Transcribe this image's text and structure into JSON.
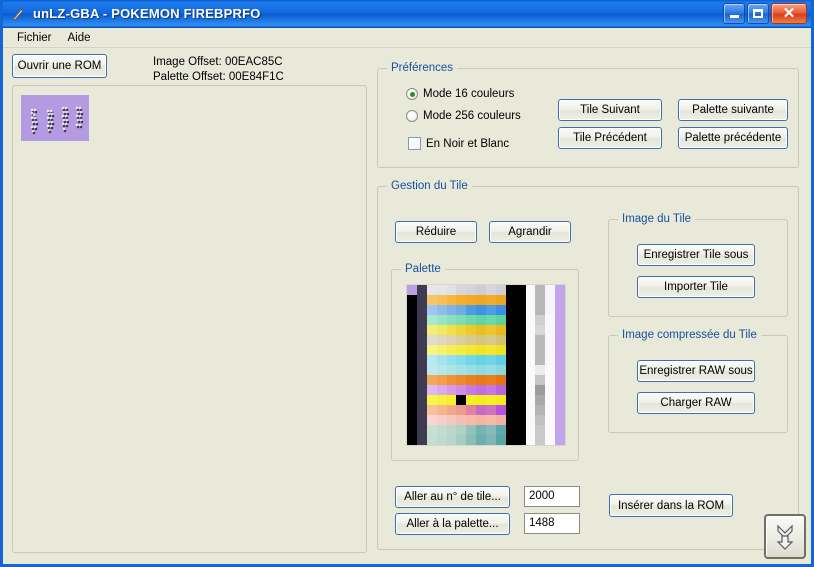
{
  "window": {
    "title": "unLZ-GBA - POKEMON FIREBPRFO",
    "app_icon": "feather-icon",
    "minimize_label": "–",
    "maximize_label": "□",
    "close_label": "✕"
  },
  "menu": {
    "items": [
      {
        "label": "Fichier"
      },
      {
        "label": "Aide"
      }
    ]
  },
  "toolbar": {
    "open_rom_label": "Ouvrir une ROM"
  },
  "offsets": {
    "image": "Image Offset: 00EAC85C",
    "palette": "Palette Offset: 00E84F1C"
  },
  "preferences": {
    "legend": "Préférences",
    "radios": [
      {
        "label": "Mode 16 couleurs",
        "selected": true
      },
      {
        "label": "Mode 256 couleurs",
        "selected": false
      }
    ],
    "checkbox": {
      "label": "En Noir et Blanc",
      "checked": false
    },
    "buttons": [
      {
        "label": "Tile Suivant"
      },
      {
        "label": "Palette suivante"
      },
      {
        "label": "Tile Précédent"
      },
      {
        "label": "Palette précédente"
      }
    ]
  },
  "tile_management": {
    "legend": "Gestion du Tile",
    "reduce_label": "Réduire",
    "enlarge_label": "Agrandir",
    "palette": {
      "legend": "Palette"
    },
    "tile_image": {
      "legend": "Image du Tile",
      "save_label": "Enregistrer Tile sous",
      "import_label": "Importer Tile"
    },
    "compressed_image": {
      "legend": "Image compressée du Tile",
      "save_raw_label": "Enregistrer RAW sous",
      "load_raw_label": "Charger RAW"
    },
    "goto_tile_label": "Aller au n° de tile...",
    "goto_palette_label": "Aller à la palette...",
    "tile_number_value": "2000",
    "palette_number_value": "1488",
    "insert_rom_label": "Insérer dans la ROM",
    "scroll_down_icon": "double-down-arrow-icon"
  },
  "colors": {
    "window_background": "#E9E9DA",
    "title_bar": "#1168E0",
    "group_legend": "#14509E",
    "button_border": "#3C6FAE",
    "radio_dot": "#2E8B2E",
    "tile_preview_bg": "#B49AE0"
  },
  "palette_grid": {
    "columns": 16,
    "rows": 16,
    "swatches": [
      "#BBA0E4",
      "#3E3B52",
      "#E6E5E8",
      "#E5E4E7",
      "#E1E0E4",
      "#D7D6DC",
      "#D4D3D9",
      "#CFCED5",
      "#D6D5DB",
      "#CFCFD6",
      "#000000",
      "#000000",
      "#FAFAFA",
      "#B8B8B8",
      "#F6F5FA",
      "#C2A4EA",
      "#000000",
      "#3E3B52",
      "#F6C46A",
      "#F9C055",
      "#F7B73F",
      "#F4AE2C",
      "#F2AA26",
      "#F0A61F",
      "#F2AC2B",
      "#EFA51D",
      "#000000",
      "#000000",
      "#FAFAFA",
      "#B8B8B8",
      "#F6F5FA",
      "#C2A4EA",
      "#000000",
      "#3E3B52",
      "#9EC6EE",
      "#8FBDEB",
      "#7FB4E8",
      "#6FABE5",
      "#4E9BE4",
      "#3E92E2",
      "#4F9CE4",
      "#3A90E1",
      "#000000",
      "#000000",
      "#FAFAFA",
      "#B8B8B8",
      "#F6F5FA",
      "#C2A4EA",
      "#000000",
      "#3E3B52",
      "#A8E8CE",
      "#98E4C4",
      "#8AE0BC",
      "#7CDCB3",
      "#6ED8AA",
      "#62D5A3",
      "#6CD7AA",
      "#5DD3A0",
      "#000000",
      "#000000",
      "#FAFAFA",
      "#CFCFCF",
      "#F8F7FB",
      "#C2A4EA",
      "#000000",
      "#3E3B52",
      "#F3EE7A",
      "#F2E962",
      "#F1E04A",
      "#EFD636",
      "#EDC92A",
      "#EBBF20",
      "#EDC72A",
      "#E9BB1C",
      "#000000",
      "#000000",
      "#FAFAFA",
      "#D8D8D8",
      "#F8F7FB",
      "#C2A4EA",
      "#000000",
      "#3E3B52",
      "#E0DCCC",
      "#DFD8BE",
      "#DDD3AE",
      "#DBCE9E",
      "#D9C98E",
      "#D7C47F",
      "#D9C88B",
      "#D5C178",
      "#000000",
      "#000000",
      "#FAFAFA",
      "#B9B9B9",
      "#FAF6FB",
      "#C2A4EA",
      "#000000",
      "#3E3B52",
      "#F7F485",
      "#F6F26C",
      "#F5EF55",
      "#F4ED41",
      "#F2E92F",
      "#F0E524",
      "#F2E82D",
      "#EFE31F",
      "#000000",
      "#000000",
      "#FAFAFA",
      "#B9B9B9",
      "#FAF6FB",
      "#C2A4EA",
      "#000000",
      "#3E3B52",
      "#B6E9F4",
      "#A4E4F2",
      "#93DFEF",
      "#83DBEC",
      "#73D6EA",
      "#66D2E8",
      "#71D5E9",
      "#5ECFE6",
      "#000000",
      "#000000",
      "#FAFAFA",
      "#B9B9B9",
      "#FAF6FB",
      "#C2A4EA",
      "#000000",
      "#3E3B52",
      "#BFE9EA",
      "#B6E7E9",
      "#ACE4E7",
      "#A2E1E5",
      "#98DEE3",
      "#90DBE1",
      "#97DDE2",
      "#8AD9E0",
      "#000000",
      "#000000",
      "#FAFAFA",
      "#ECECEC",
      "#FDF9FC",
      "#C2A4EA",
      "#000000",
      "#3E3B52",
      "#F2A95E",
      "#F19F4C",
      "#EF933A",
      "#ED8A2C",
      "#EA801F",
      "#E87915",
      "#EB7E1D",
      "#E67410",
      "#000000",
      "#000000",
      "#FAFAFA",
      "#C6C6C6",
      "#FDF9FC",
      "#C2A4EA",
      "#000000",
      "#3E3B52",
      "#E0B7EE",
      "#DCA9EC",
      "#D79BEA",
      "#D28CE8",
      "#C67AE4",
      "#BE6FE2",
      "#C578E3",
      "#B863E0",
      "#000000",
      "#000000",
      "#FAFAFA",
      "#9C9C9C",
      "#FDF9FC",
      "#C2A4EA",
      "#000000",
      "#3E3B52",
      "#F8F44A",
      "#F7F33C",
      "#F6F130",
      "000000",
      "#F5EF24",
      "#F4EE1C",
      "#F5F024",
      "#F3EC16",
      "#000000",
      "#000000",
      "#FAFAFA",
      "#AAAAAA",
      "#FEFAFD",
      "#C2A4EA",
      "#000000",
      "#3E3B52",
      "#F6C29A",
      "#F4B78D",
      "#F0A98A",
      "#EC9C8C",
      "#DE84A0",
      "#C869C6",
      "#CE72C0",
      "#B84FE0",
      "#000000",
      "#000000",
      "#FAFAFA",
      "#B4B4B4",
      "#FEFAFD",
      "#C2A4EA",
      "#000000",
      "#3E3B52",
      "#F8D4D2",
      "#F8CEC9",
      "#F7C6BD",
      "#F6BEB2",
      "#F6B9AA",
      "#F6B5A4",
      "#F6B8A8",
      "#F5B29E",
      "#000000",
      "#000000",
      "#FAFAFA",
      "#C0C0C0",
      "#FEFAFD",
      "#C2A4EA",
      "#000000",
      "#3E3B52",
      "#C8DFD4",
      "#C2DCD1",
      "#BCD8CC",
      "#AFD0C4",
      "#93C2BC",
      "#75B4B4",
      "#86BBB8",
      "#5FA9AC",
      "#000000",
      "#000000",
      "#FAFAFA",
      "#CACACA",
      "#FEFAFD",
      "#C2A4EA",
      "#000000",
      "#3E3B52",
      "#C5DDD3",
      "#BFDAD0",
      "#B7D5CB",
      "#A8CCC2",
      "#8BBDB8",
      "#6DAFB0",
      "#7FB6B4",
      "#58A5A8",
      "#000000",
      "#000000",
      "#FAFAFA",
      "#CACACA",
      "#FEFAFD",
      "#C2A4EA"
    ]
  }
}
